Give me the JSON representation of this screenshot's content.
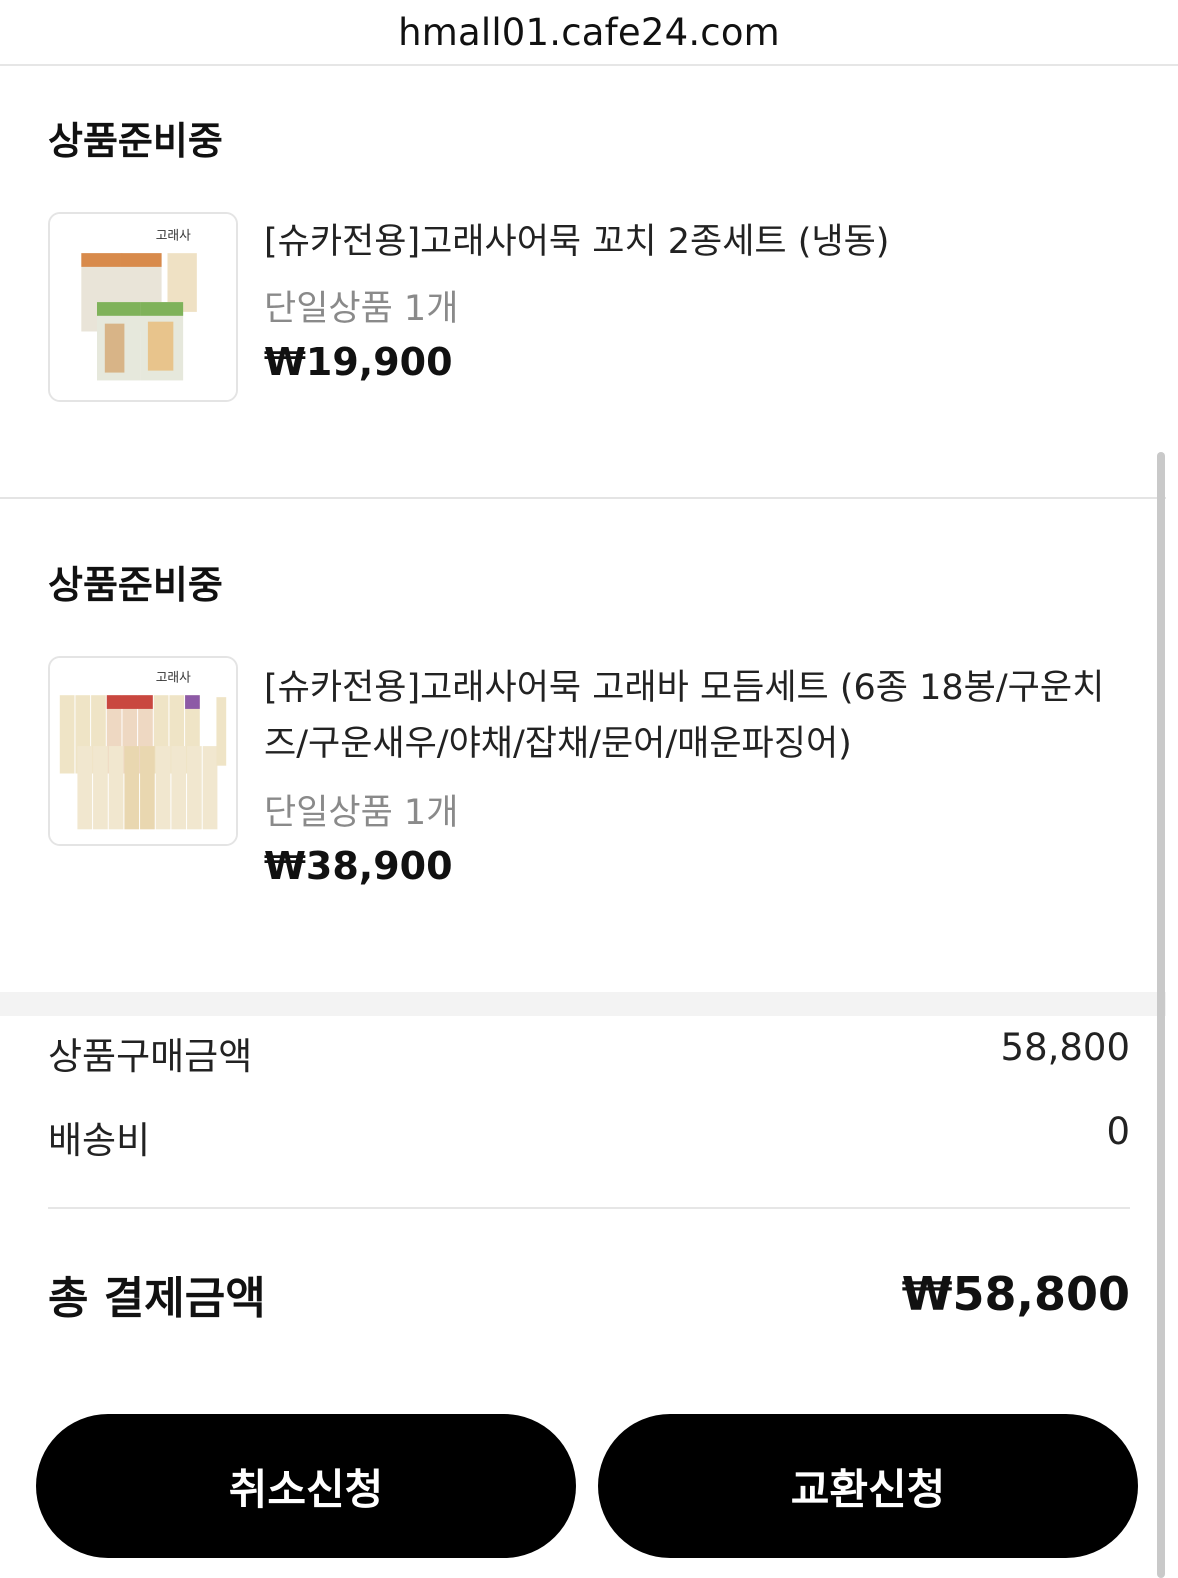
{
  "browser": {
    "url": "hmall01.cafe24.com"
  },
  "orders": [
    {
      "status": "상품준비중",
      "name": "[슈카전용]고래사어묵 꼬치 2종세트 (냉동)",
      "option": "단일상품 1개",
      "price": "₩19,900",
      "thumbnail": "fishcake-skewer-set-image"
    },
    {
      "status": "상품준비중",
      "name": "[슈카전용]고래사어묵 고래바 모듬세트 (6종 18봉/구운치즈/구운새우/야채/잡채/문어/매운파징어)",
      "option": "단일상품 1개",
      "price": "₩38,900",
      "thumbnail": "fishcake-bar-assortment-image"
    }
  ],
  "summary": {
    "product_amount_label": "상품구매금액",
    "product_amount_value": "58,800",
    "shipping_label": "배송비",
    "shipping_value": "0",
    "total_label": "총 결제금액",
    "total_value": "₩58,800"
  },
  "actions": {
    "cancel_label": "취소신청",
    "exchange_label": "교환신청"
  },
  "colors": {
    "button_bg": "#000000",
    "button_text": "#ffffff",
    "muted_text": "#8a8a8a"
  }
}
